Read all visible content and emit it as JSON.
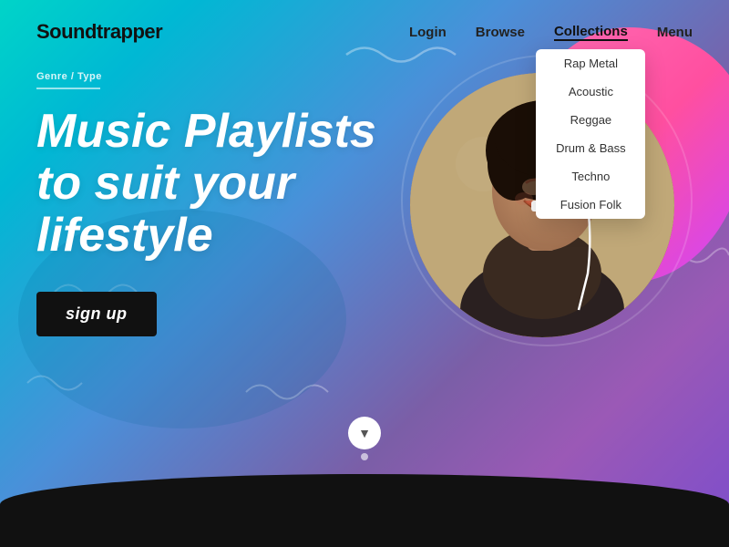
{
  "logo": {
    "text": "Soundtrapper"
  },
  "nav": {
    "login": "Login",
    "browse": "Browse",
    "collections": "Collections",
    "menu": "Menu"
  },
  "dropdown": {
    "items": [
      "Rap Metal",
      "Acoustic",
      "Reggae",
      "Drum & Bass",
      "Techno",
      "Fusion Folk"
    ]
  },
  "hero": {
    "breadcrumb": "Genre / Type",
    "title_line1": "Music Playlists",
    "title_line2": "to suit your",
    "title_line3": "lifestyle",
    "cta": "sign up"
  },
  "scroll": {
    "icon": "▼"
  },
  "colors": {
    "gradient_start": "#00d4c8",
    "gradient_end": "#7c4dcc",
    "accent_pink": "#ff4fa0",
    "dark": "#111111"
  }
}
